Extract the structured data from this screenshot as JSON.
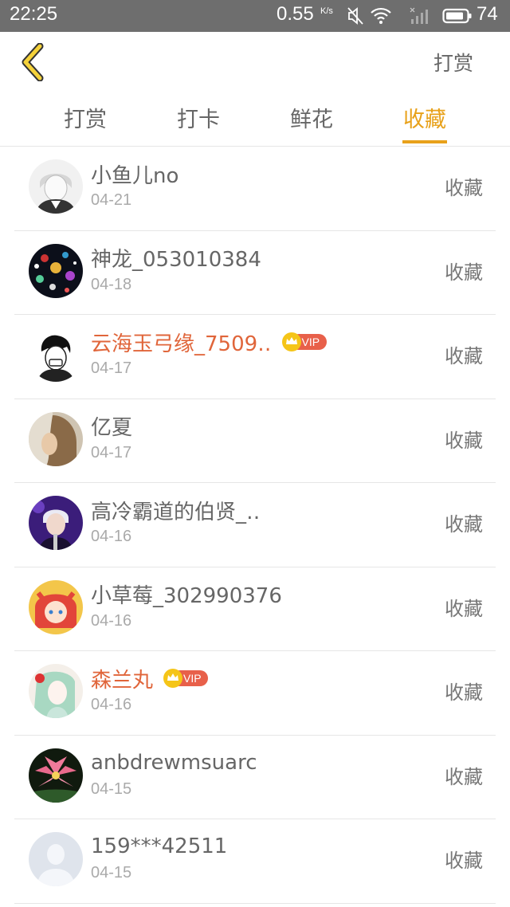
{
  "status_bar": {
    "time": "22:25",
    "speed": "0.55",
    "speed_unit": "K/s",
    "battery": "74"
  },
  "header": {
    "back_icon": "chevron-left-icon",
    "action_label": "打赏"
  },
  "tabs": [
    {
      "label": "打赏",
      "active": false
    },
    {
      "label": "打卡",
      "active": false
    },
    {
      "label": "鲜花",
      "active": false
    },
    {
      "label": "收藏",
      "active": true
    }
  ],
  "accent_color": "#e8a11a",
  "vip_name_color": "#e0653a",
  "list": [
    {
      "name": "小鱼儿no",
      "date": "04-21",
      "action": "收藏",
      "vip": false
    },
    {
      "name": "神龙_053010384",
      "date": "04-18",
      "action": "收藏",
      "vip": false
    },
    {
      "name": "云海玉弓缘_7509‥",
      "date": "04-17",
      "action": "收藏",
      "vip": true,
      "vip_label": "VIP"
    },
    {
      "name": "亿夏",
      "date": "04-17",
      "action": "收藏",
      "vip": false
    },
    {
      "name": "高冷霸道的伯贤_‥",
      "date": "04-16",
      "action": "收藏",
      "vip": false
    },
    {
      "name": "小草莓_302990376",
      "date": "04-16",
      "action": "收藏",
      "vip": false
    },
    {
      "name": "森兰丸",
      "date": "04-16",
      "action": "收藏",
      "vip": true,
      "vip_label": "VIP"
    },
    {
      "name": "anbdrewmsuarc",
      "date": "04-15",
      "action": "收藏",
      "vip": false
    },
    {
      "name": "159***42511",
      "date": "04-15",
      "action": "收藏",
      "vip": false
    }
  ]
}
